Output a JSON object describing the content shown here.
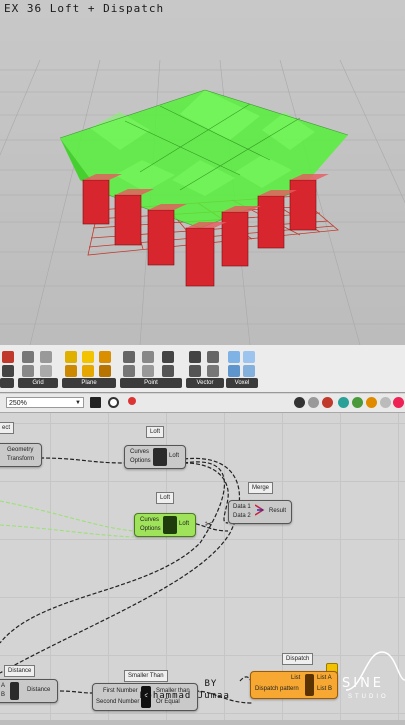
{
  "viewport": {
    "title": "EX 36 Loft + Dispatch"
  },
  "ribbon": {
    "groups": [
      "Grid",
      "Plane",
      "Point",
      "Vector",
      "Voxel"
    ]
  },
  "toolbar": {
    "zoom": "250%"
  },
  "nodes": {
    "select_tag": "ect",
    "geom": {
      "in1": "Geometry",
      "in2": "Transform"
    },
    "loft1_tag": "Loft",
    "loft1": {
      "in1": "Curves",
      "in2": "Options",
      "out": "Loft"
    },
    "loft2_tag": "Loft",
    "loft2": {
      "in1": "Curves",
      "in2": "Options",
      "out": "Loft"
    },
    "merge_tag": "Merge",
    "merge": {
      "in1": "Data 1",
      "in2": "Data 2",
      "out": "Result"
    },
    "distance_tag": "Distance",
    "distance": {
      "in1": "A",
      "in2": "B",
      "out": "Distance"
    },
    "smaller_tag": "Smaller Than",
    "smaller": {
      "in1": "First Number",
      "in2": "Second Number",
      "out1": "Smaller than",
      "out2": "Or Equal"
    },
    "dispatch_tag": "Dispatch",
    "dispatch": {
      "in1": "List",
      "in2": "Dispatch pattern",
      "out1": "List A",
      "out2": "List B"
    }
  },
  "credit": {
    "line1": "BY",
    "line2": "Mohammad Jumaa"
  },
  "logo": {
    "word": "SINE",
    "sub": "STUDIO"
  }
}
